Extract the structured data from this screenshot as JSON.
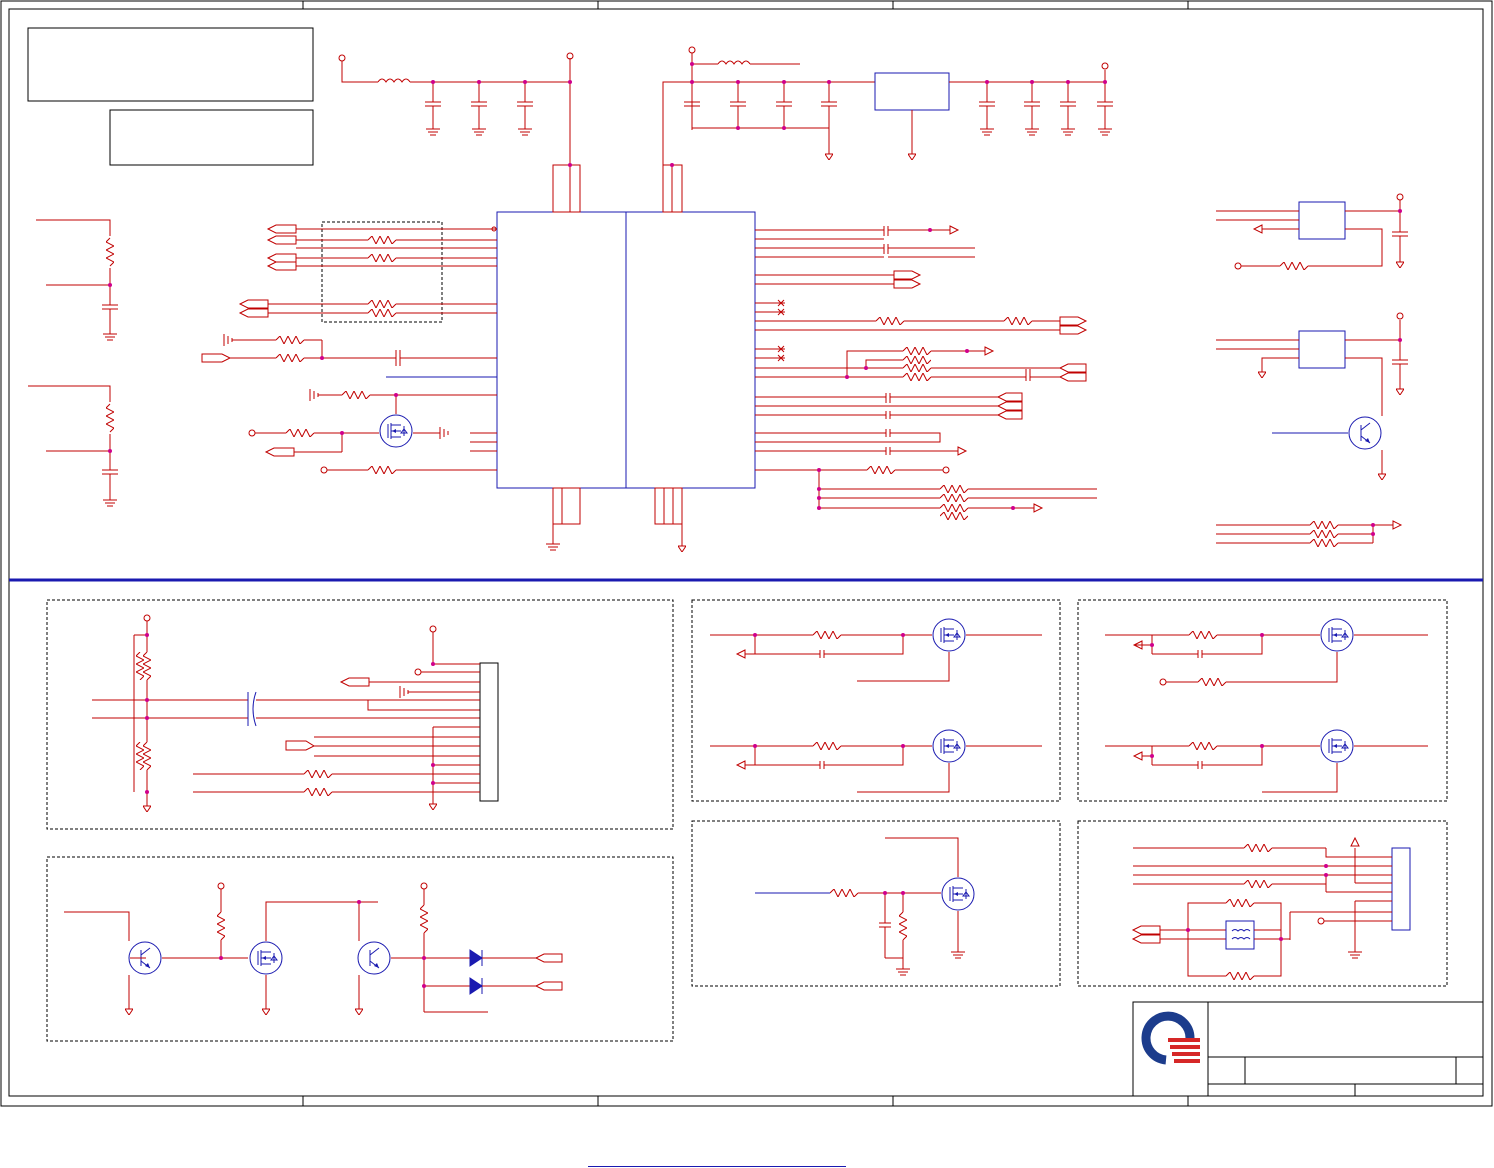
{
  "document": {
    "type": "schematic-sheet",
    "title_block": {
      "logo": "quanta-logo",
      "title": "",
      "size": "",
      "document_number": "",
      "rev": "",
      "date": "",
      "sheet": ""
    },
    "notes": [
      "",
      ""
    ],
    "footer_link": ""
  },
  "colors": {
    "wire": "#c00000",
    "component": "#1a1ab0",
    "junction": "#d0008c",
    "frame": "#000000",
    "divider": "#1a1ab0",
    "logo_blue": "#1c3c8c",
    "logo_red": "#d62828"
  },
  "sections": [
    "top-main-ic-area",
    "bottom-connector-block",
    "bottom-transistor-led-block",
    "mosfet-pair-left",
    "mosfet-pair-right",
    "mosfet-single",
    "connector-with-transformer"
  ]
}
